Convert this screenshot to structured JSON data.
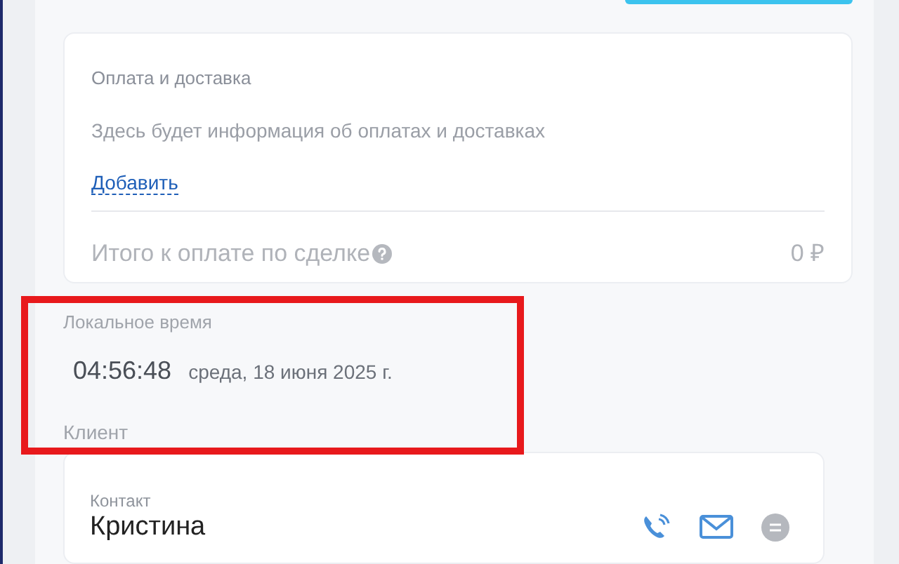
{
  "payment_card": {
    "title": "Оплата и доставка",
    "info": "Здесь будет информация об оплатах и доставках",
    "add_link": "Добавить",
    "total_label": "Итого к оплате по сделке",
    "total_value": "0 ₽"
  },
  "local_time": {
    "label": "Локальное время",
    "time": "04:56:48",
    "date": "среда, 18 июня 2025 г."
  },
  "client": {
    "label": "Клиент",
    "contact_label": "Контакт",
    "contact_name": "Кристина"
  }
}
